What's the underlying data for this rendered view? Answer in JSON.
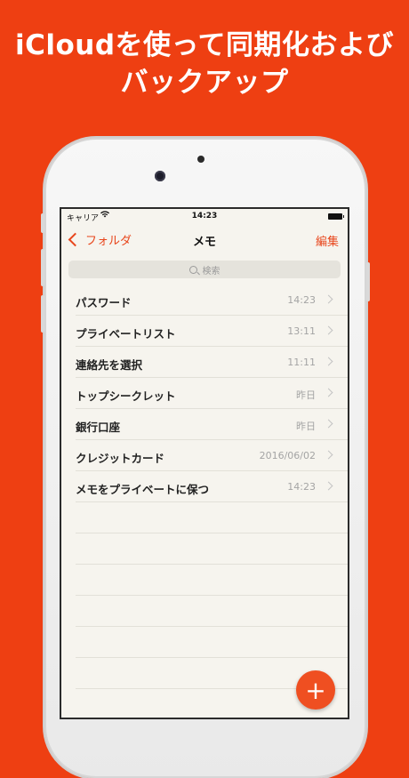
{
  "headline": {
    "line1": "iCloudを使って同期化および",
    "line2": "バックアップ"
  },
  "status": {
    "carrier": "キャリア",
    "time": "14:23"
  },
  "nav": {
    "back_label": "フォルダ",
    "title": "メモ",
    "edit_label": "編集"
  },
  "search": {
    "placeholder": "検索"
  },
  "notes": [
    {
      "title": "パスワード",
      "date": "14:23"
    },
    {
      "title": "プライベートリスト",
      "date": "13:11"
    },
    {
      "title": "連絡先を選択",
      "date": "11:11"
    },
    {
      "title": "トップシークレット",
      "date": "昨日"
    },
    {
      "title": "銀行口座",
      "date": "昨日"
    },
    {
      "title": "クレジットカード",
      "date": "2016/06/02"
    },
    {
      "title": "メモをプライベートに保つ",
      "date": "14:23"
    }
  ],
  "fab": {
    "label": "+"
  },
  "colors": {
    "background": "#ee3f12",
    "accent": "#e8461c",
    "paper": "#f6f4ee"
  }
}
